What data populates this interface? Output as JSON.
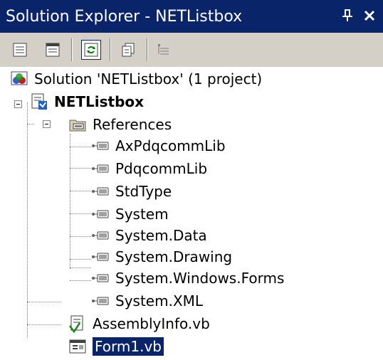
{
  "window": {
    "title": "Solution Explorer - NETListbox",
    "pin_glyph": "⬇",
    "close_glyph": "✕"
  },
  "toolbar": {
    "buttons": [
      {
        "icon": "properties-icon"
      },
      {
        "icon": "view-designer-icon"
      },
      {
        "icon": "refresh-icon",
        "active": true
      },
      {
        "icon": "show-all-files-icon"
      },
      {
        "icon": "class-view-icon"
      }
    ]
  },
  "tree": {
    "solution": "Solution 'NETListbox' (1 project)",
    "project": "NETListbox",
    "references_folder": "References",
    "references": [
      "AxPdqcommLib",
      "PdqcommLib",
      "StdType",
      "System",
      "System.Data",
      "System.Drawing",
      "System.Windows.Forms",
      "System.XML"
    ],
    "files": [
      "AssemblyInfo.vb",
      "Form1.vb"
    ],
    "selected_file": "Form1.vb"
  },
  "colors": {
    "title_bar": "#0a246a",
    "toolbar": "#d4d0c8",
    "selection": "#0a246a"
  }
}
